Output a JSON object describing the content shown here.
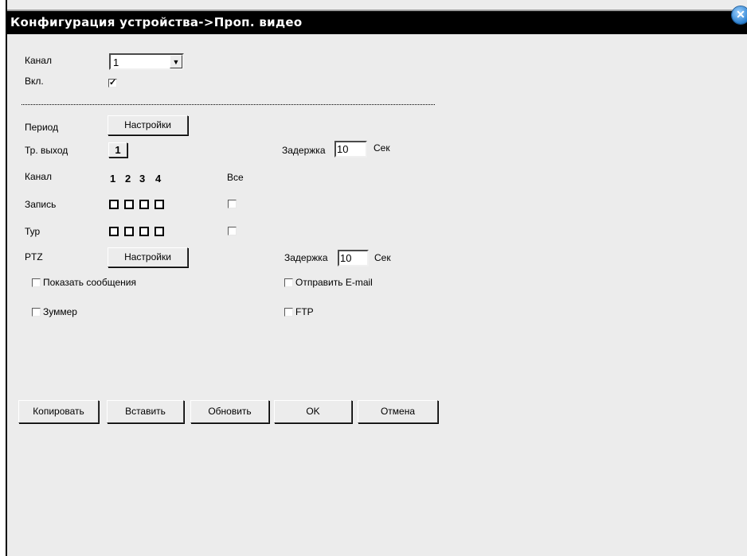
{
  "window": {
    "title": "Конфигурация устройства->Проп. видео",
    "close_icon": "close-icon"
  },
  "form": {
    "channel_label": "Канал",
    "channel_value": "1",
    "enable_label": "Вкл.",
    "enable_checked": true,
    "period_label": "Период",
    "settings_label": "Настройки",
    "alarm_out_label": "Тр. выход",
    "alarm_out_value": "1",
    "delay_label": "Задержка",
    "delay_value": "10",
    "delay_unit": "Сек",
    "channels_label": "Канал",
    "channel_numbers": [
      "1",
      "2",
      "3",
      "4"
    ],
    "all_label": "Все",
    "record_label": "Запись",
    "tour_label": "Тур",
    "ptz_label": "PTZ",
    "ptz_settings_label": "Настройки",
    "ptz_delay_label": "Задержка",
    "ptz_delay_value": "10",
    "ptz_delay_unit": "Сек",
    "show_message_label": "Показать сообщения",
    "send_email_label": "Отправить E-mail",
    "buzzer_label": "Зуммер",
    "ftp_label": "FTP"
  },
  "buttons": {
    "copy": "Копировать",
    "paste": "Вставить",
    "refresh": "Обновить",
    "ok": "OK",
    "cancel": "Отмена"
  }
}
